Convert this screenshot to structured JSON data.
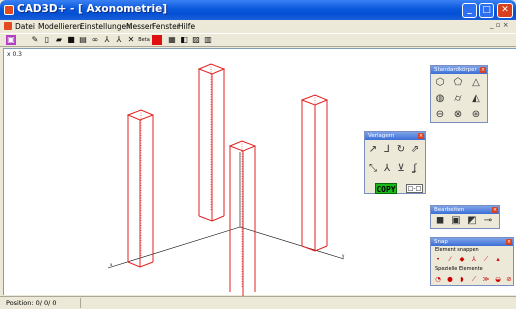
{
  "window": {
    "title": "CAD3D+ - [ Axonometrie]",
    "buttons": {
      "minimize": "_",
      "maximize": "□",
      "close": "✕"
    }
  },
  "menu": {
    "items": [
      "Datei",
      "Modellieren",
      "Einstellungen",
      "Messen",
      "Fenster",
      "Hilfe"
    ],
    "mdi_controls": "_ ▫ ×"
  },
  "toolbar": {
    "icons": [
      "palette-icon",
      "pencil-icon",
      "new-file-icon",
      "open-folder-icon",
      "save-icon",
      "print-icon",
      "glasses-icon",
      "axes-icon",
      "axis-icon",
      "cross-icon",
      "text-icon",
      "red-square-icon",
      "grid-icon",
      "view-icon",
      "pattern-icon",
      "columns-icon"
    ],
    "text_button": "Beta"
  },
  "canvas": {
    "coord_label": "x 0.3",
    "colors": {
      "box_edge": "#e02020",
      "axis": "#000000"
    }
  },
  "status": {
    "position": "Position: 0/ 0/ 0"
  },
  "palettes": {
    "standardkoerper": {
      "title": "Standardkörper"
    },
    "verlagern": {
      "title": "Verlagern",
      "copy_label": "COPY"
    },
    "bearbeiten": {
      "title": "Bearbeiten"
    },
    "snap": {
      "title": "Snap",
      "section1": "Element snappen",
      "section2": "Spezielle Elemente"
    }
  }
}
